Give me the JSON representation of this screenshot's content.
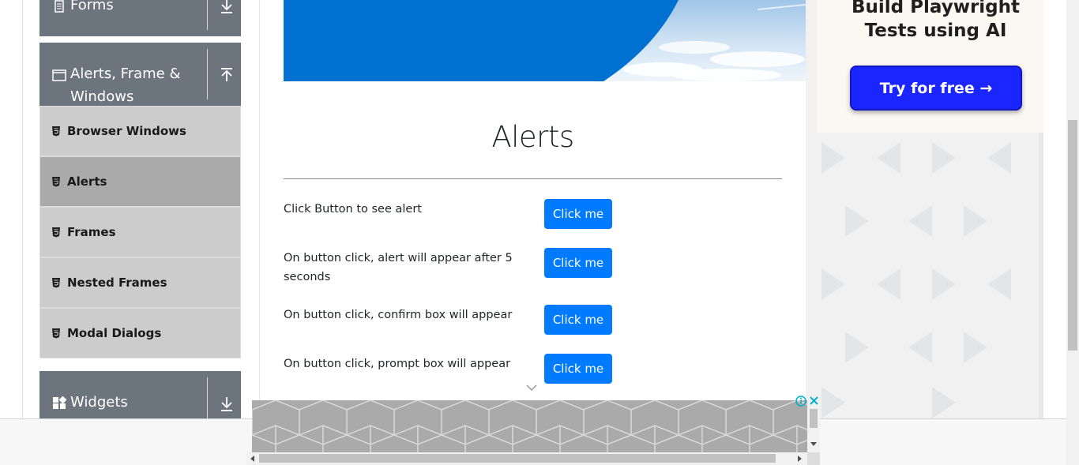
{
  "sidebar": {
    "groups": [
      {
        "name": "forms",
        "label": "Forms"
      },
      {
        "name": "alerts",
        "label_line1": "Alerts, Frame &",
        "label_line2": "Windows"
      },
      {
        "name": "widgets",
        "label": "Widgets"
      }
    ],
    "items": [
      {
        "label": "Browser Windows",
        "active": false
      },
      {
        "label": "Alerts",
        "active": true
      },
      {
        "label": "Frames",
        "active": false
      },
      {
        "label": "Nested Frames",
        "active": false
      },
      {
        "label": "Modal Dialogs",
        "active": false
      }
    ]
  },
  "main": {
    "title": "Alerts",
    "rows": [
      {
        "label": "Click Button to see alert",
        "button": "Click me"
      },
      {
        "label_line1": "On button click, alert will appear after 5",
        "label_line2": "seconds",
        "button": "Click me"
      },
      {
        "label": "On button click, confirm box will appear",
        "button": "Click me"
      },
      {
        "label": "On button click, prompt box will appear",
        "button": "Click me"
      }
    ]
  },
  "ad_right": {
    "headline_line1": "Build Playwright",
    "headline_line2": "Tests using AI",
    "cta": "Try for free →"
  },
  "colors": {
    "sidebar_header": "#6c757d",
    "menu_item": "#cccccc",
    "menu_item_active": "#aaaaaa",
    "button_primary": "#007bff",
    "banner_blue": "#0070d1",
    "ad_cta": "#1a25ff"
  }
}
